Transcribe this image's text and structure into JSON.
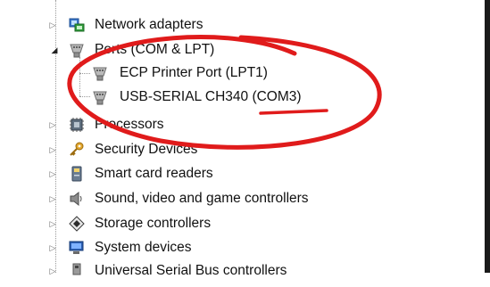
{
  "device_tree": {
    "items": [
      {
        "label": "Network adapters",
        "icon": "network-adapter-icon",
        "state": "collapsed"
      },
      {
        "label": "Ports (COM & LPT)",
        "icon": "port-connector-icon",
        "state": "expanded"
      },
      {
        "label": "ECP Printer Port (LPT1)",
        "icon": "port-connector-icon",
        "state": "leaf"
      },
      {
        "label": "USB-SERIAL CH340 (COM3)",
        "icon": "port-connector-icon",
        "state": "leaf"
      },
      {
        "label": "Processors",
        "icon": "processor-chip-icon",
        "state": "collapsed"
      },
      {
        "label": "Security Devices",
        "icon": "security-key-icon",
        "state": "collapsed"
      },
      {
        "label": "Smart card readers",
        "icon": "smart-card-reader-icon",
        "state": "collapsed"
      },
      {
        "label": "Sound, video and game controllers",
        "icon": "speaker-icon",
        "state": "collapsed"
      },
      {
        "label": "Storage controllers",
        "icon": "storage-controller-icon",
        "state": "collapsed"
      },
      {
        "label": "System devices",
        "icon": "system-devices-icon",
        "state": "collapsed"
      },
      {
        "label": "Universal Serial Bus controllers",
        "icon": "usb-connector-icon",
        "state": "collapsed"
      }
    ]
  },
  "annotation": {
    "color": "#e01b1b"
  }
}
